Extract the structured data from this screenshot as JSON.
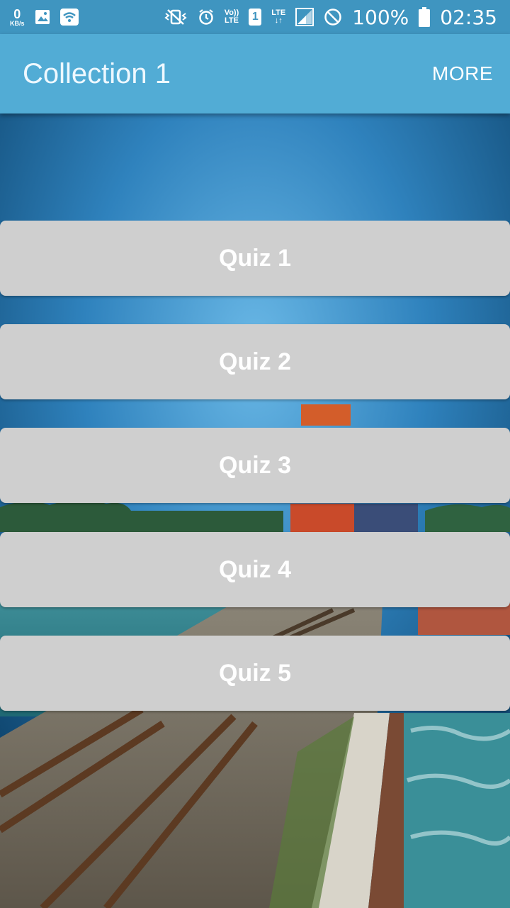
{
  "status_bar": {
    "network_speed": "0",
    "network_unit": "KB/s",
    "volte_label_top": "Vo))",
    "volte_label_bottom": "LTE",
    "sim_slot": "1",
    "lte_label": "LTE",
    "battery_percent": "100%",
    "time": "02:35",
    "icons": [
      "image-icon",
      "wifi-icon",
      "vibrate-icon",
      "alarm-icon",
      "signal-icon",
      "dnd-icon",
      "battery-icon"
    ]
  },
  "app_bar": {
    "title": "Collection 1",
    "more_label": "MORE"
  },
  "quizzes": [
    {
      "label": "Quiz 1"
    },
    {
      "label": "Quiz 2"
    },
    {
      "label": "Quiz 3"
    },
    {
      "label": "Quiz 4"
    },
    {
      "label": "Quiz 5"
    }
  ],
  "colors": {
    "status_bar": "#3f95c0",
    "app_bar": "#52acd5",
    "quiz_button": "#cfcfcf",
    "quiz_text": "#ffffff"
  }
}
